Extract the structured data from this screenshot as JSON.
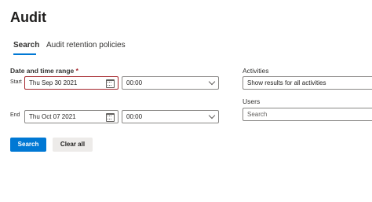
{
  "page": {
    "title": "Audit"
  },
  "tabs": [
    {
      "label": "Search",
      "active": true
    },
    {
      "label": "Audit retention policies",
      "active": false
    }
  ],
  "date_range": {
    "label": "Date and time range",
    "required_marker": "*",
    "start": {
      "label": "Start",
      "date": "Thu Sep 30 2021",
      "time": "00:00",
      "error": true
    },
    "end": {
      "label": "End",
      "date": "Thu Oct 07 2021",
      "time": "00:00",
      "error": false
    }
  },
  "activities": {
    "label": "Activities",
    "value": "Show results for all activities"
  },
  "users": {
    "label": "Users",
    "placeholder": "Search"
  },
  "buttons": {
    "search": "Search",
    "clear": "Clear all"
  },
  "colors": {
    "accent": "#0078d4",
    "error_border": "#a4262c",
    "secondary_button": "#edebe9"
  }
}
